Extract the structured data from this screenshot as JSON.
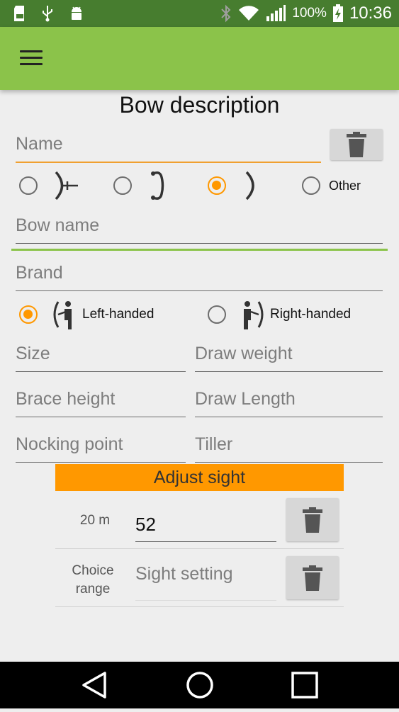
{
  "status_bar": {
    "battery_percent": "100%",
    "time": "10:36",
    "left_icons": [
      "sd-card-icon",
      "usb-icon",
      "android-debug-icon"
    ],
    "right_icons": [
      "bluetooth-icon",
      "wifi-icon",
      "signal-icon",
      "battery-charging-icon"
    ]
  },
  "app_bar": {
    "menu_icon": "hamburger-menu-icon",
    "color": "#8bc34a"
  },
  "form": {
    "title": "Bow description",
    "name_placeholder": "Name",
    "bow_types": [
      {
        "icon": "compound-bow-icon",
        "selected": false
      },
      {
        "icon": "recurve-bow-icon",
        "selected": false
      },
      {
        "icon": "longbow-icon",
        "selected": true
      },
      {
        "label": "Other",
        "selected": false
      }
    ],
    "bow_name_placeholder": "Bow name",
    "brand_placeholder": "Brand",
    "handedness": [
      {
        "label": "Left-handed",
        "icon": "left-handed-archer-icon",
        "selected": true
      },
      {
        "label": "Right-handed",
        "icon": "right-handed-archer-icon",
        "selected": false
      }
    ],
    "size_placeholder": "Size",
    "draw_weight_placeholder": "Draw weight",
    "brace_height_placeholder": "Brace height",
    "draw_length_placeholder": "Draw Length",
    "nocking_point_placeholder": "Nocking point",
    "tiller_placeholder": "Tiller"
  },
  "sight": {
    "header": "Adjust sight",
    "header_color": "#ff9800",
    "rows": [
      {
        "distance": "20 m",
        "value": "52",
        "delete_icon": "trash-icon"
      },
      {
        "distance_line1": "Choice",
        "distance_line2": "range",
        "placeholder": "Sight setting",
        "delete_icon": "trash-icon"
      }
    ]
  },
  "nav_bar": {
    "buttons": [
      "back-icon",
      "home-icon",
      "recents-icon"
    ]
  }
}
